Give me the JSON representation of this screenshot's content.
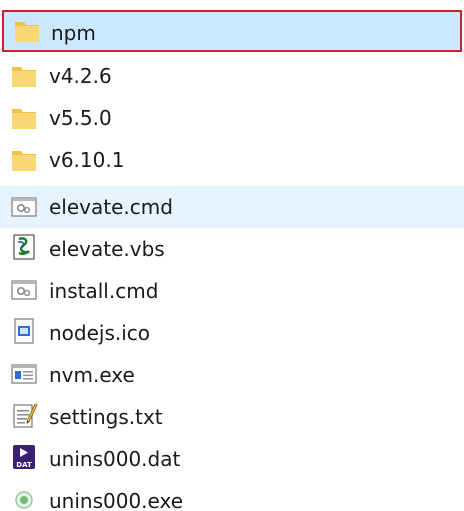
{
  "items": [
    {
      "name": "npm",
      "icon": "folder-icon"
    },
    {
      "name": "v4.2.6",
      "icon": "folder-icon"
    },
    {
      "name": "v5.5.0",
      "icon": "folder-icon"
    },
    {
      "name": "v6.10.1",
      "icon": "folder-icon"
    },
    {
      "name": "elevate.cmd",
      "icon": "cmd-script-icon"
    },
    {
      "name": "elevate.vbs",
      "icon": "vbs-script-icon"
    },
    {
      "name": "install.cmd",
      "icon": "cmd-script-icon"
    },
    {
      "name": "nodejs.ico",
      "icon": "ico-image-icon"
    },
    {
      "name": "nvm.exe",
      "icon": "exe-application-icon"
    },
    {
      "name": "settings.txt",
      "icon": "text-document-icon"
    },
    {
      "name": "unins000.dat",
      "icon": "dat-file-icon"
    },
    {
      "name": "unins000.exe",
      "icon": "installer-exe-icon"
    }
  ],
  "colors": {
    "selection": "#cce8ff",
    "hover": "#e5f3ff",
    "focus_border": "#c8252b",
    "folder": "#f8d775"
  }
}
